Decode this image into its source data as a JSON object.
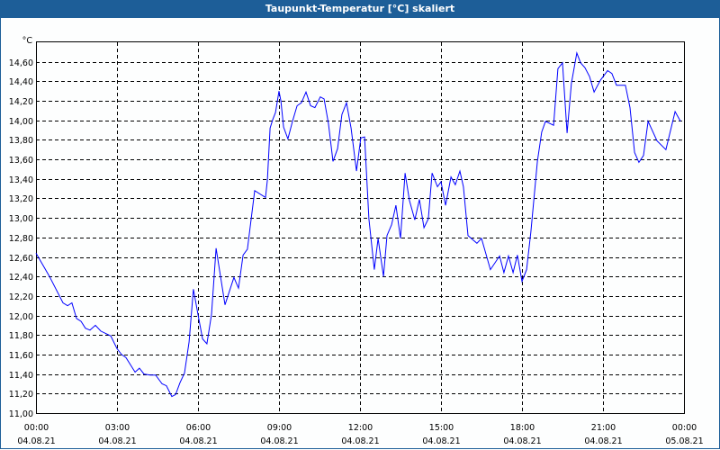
{
  "window": {
    "title": "Taupunkt-Temperatur [°C] skaliert"
  },
  "chart_data": {
    "type": "line",
    "title": "Taupunkt-Temperatur [°C] skaliert",
    "ylabel": "°C",
    "xlabel": "",
    "ylim": [
      11.0,
      14.8
    ],
    "xlim_hours": [
      0,
      24
    ],
    "grid": true,
    "line_color": "#0000ff",
    "y_ticks": [
      "11,00",
      "11,20",
      "11,40",
      "11,60",
      "11,80",
      "12,00",
      "12,20",
      "12,40",
      "12,60",
      "12,80",
      "13,00",
      "13,20",
      "13,40",
      "13,60",
      "13,80",
      "14,00",
      "14,20",
      "14,40",
      "14,60"
    ],
    "x_ticks": [
      {
        "time": "00:00",
        "date": "04.08.21"
      },
      {
        "time": "03:00",
        "date": "04.08.21"
      },
      {
        "time": "06:00",
        "date": "04.08.21"
      },
      {
        "time": "09:00",
        "date": "04.08.21"
      },
      {
        "time": "12:00",
        "date": "04.08.21"
      },
      {
        "time": "15:00",
        "date": "04.08.21"
      },
      {
        "time": "18:00",
        "date": "04.08.21"
      },
      {
        "time": "21:00",
        "date": "04.08.21"
      },
      {
        "time": "00:00",
        "date": "05.08.21"
      }
    ],
    "series": [
      {
        "name": "Taupunkt-Temperatur",
        "x_hours": [
          0,
          0.5,
          1.0,
          1.17,
          1.33,
          1.5,
          1.67,
          1.83,
          2.0,
          2.2,
          2.4,
          2.77,
          3.0,
          3.17,
          3.33,
          3.67,
          3.83,
          4.0,
          4.23,
          4.43,
          4.67,
          4.83,
          5.03,
          5.17,
          5.33,
          5.5,
          5.67,
          5.83,
          6.0,
          6.17,
          6.33,
          6.5,
          6.67,
          7.0,
          7.33,
          7.5,
          7.67,
          7.83,
          8.1,
          8.5,
          8.57,
          8.67,
          8.77,
          8.87,
          9.0,
          9.07,
          9.17,
          9.33,
          9.5,
          9.67,
          9.83,
          10.0,
          10.17,
          10.33,
          10.53,
          10.67,
          10.83,
          11.0,
          11.17,
          11.33,
          11.5,
          11.67,
          11.87,
          12.03,
          12.17,
          12.33,
          12.53,
          12.67,
          12.87,
          13.0,
          13.17,
          13.33,
          13.5,
          13.67,
          13.83,
          14.03,
          14.2,
          14.37,
          14.53,
          14.67,
          14.87,
          15.0,
          15.17,
          15.37,
          15.53,
          15.7,
          15.83,
          16.0,
          16.33,
          16.5,
          16.83,
          17.17,
          17.33,
          17.5,
          17.67,
          17.83,
          18.0,
          18.17,
          18.33,
          18.57,
          18.73,
          18.87,
          19.17,
          19.33,
          19.5,
          19.67,
          19.83,
          20.03,
          20.17,
          20.33,
          20.5,
          20.67,
          20.9,
          21.17,
          21.33,
          21.5,
          21.83,
          22.0,
          22.17,
          22.33,
          22.5,
          22.67,
          23.0,
          23.33,
          23.67,
          23.87
        ],
        "values": [
          12.64,
          12.4,
          12.13,
          12.1,
          12.13,
          11.97,
          11.94,
          11.87,
          11.85,
          11.9,
          11.84,
          11.79,
          11.66,
          11.6,
          11.57,
          11.42,
          11.46,
          11.4,
          11.39,
          11.39,
          11.3,
          11.28,
          11.17,
          11.19,
          11.31,
          11.41,
          11.73,
          12.27,
          12.01,
          11.76,
          11.71,
          12.01,
          12.69,
          12.11,
          12.39,
          12.28,
          12.62,
          12.68,
          13.28,
          13.21,
          13.39,
          13.92,
          14.01,
          14.08,
          14.3,
          14.2,
          13.93,
          13.81,
          13.99,
          14.15,
          14.18,
          14.29,
          14.15,
          14.13,
          14.24,
          14.22,
          13.97,
          13.58,
          13.71,
          14.06,
          14.18,
          13.92,
          13.48,
          13.82,
          13.83,
          12.99,
          12.47,
          12.79,
          12.4,
          12.82,
          12.93,
          13.13,
          12.79,
          13.46,
          13.18,
          12.98,
          13.19,
          12.9,
          12.99,
          13.46,
          13.32,
          13.37,
          13.13,
          13.42,
          13.34,
          13.48,
          13.32,
          12.82,
          12.74,
          12.79,
          12.47,
          12.61,
          12.44,
          12.61,
          12.44,
          12.62,
          12.35,
          12.47,
          12.86,
          13.58,
          13.88,
          13.99,
          13.95,
          14.53,
          14.59,
          13.87,
          14.38,
          14.69,
          14.59,
          14.54,
          14.45,
          14.29,
          14.41,
          14.51,
          14.48,
          14.36,
          14.36,
          14.13,
          13.67,
          13.57,
          13.64,
          13.99,
          13.79,
          13.7,
          14.09,
          13.99
        ]
      }
    ]
  }
}
